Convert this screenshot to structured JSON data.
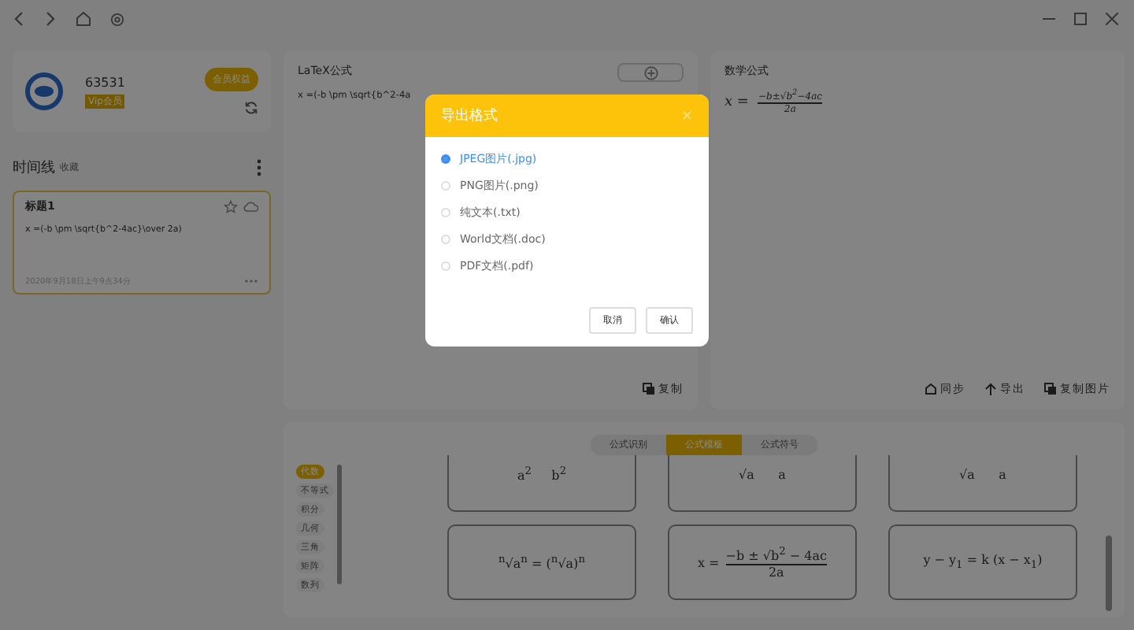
{
  "user": {
    "id": "63531",
    "badge": "Vip会员",
    "action": "会员权益"
  },
  "timeline": {
    "title": "时间线",
    "subtitle": "收藏",
    "cards": [
      {
        "title": "标题1",
        "text": "x =(-b \\pm \\sqrt{b^2-4ac}\\over 2a)",
        "date": "2020年9月18日上午9点34分",
        "selected": true
      }
    ]
  },
  "latex_panel": {
    "title": "LaTeX公式",
    "value": "x =(-b \\pm \\sqrt{b^2-4a",
    "copy": "复制"
  },
  "math_panel": {
    "title": "数学公式",
    "formula": {
      "lhs": "x =",
      "numerator": "−b±√b$^{2}$−4ac",
      "denominator": "2a"
    },
    "actions": [
      "同步",
      "导出",
      "复制图片"
    ]
  },
  "template_tabs": [
    {
      "label": "公式识别",
      "selected": false
    },
    {
      "label": "公式模板",
      "selected": true
    },
    {
      "label": "公式符号",
      "selected": false
    }
  ],
  "categories": [
    {
      "label": "代数",
      "selected": true
    },
    {
      "label": "不等式",
      "selected": false
    },
    {
      "label": "积分",
      "selected": false
    },
    {
      "label": "几何",
      "selected": false
    },
    {
      "label": "三角",
      "selected": false
    },
    {
      "label": "矩阵",
      "selected": false
    },
    {
      "label": "数列",
      "selected": false
    }
  ],
  "formulas": [
    {
      "kind": "text",
      "text": "a$^{2}$     b$^{2}$"
    },
    {
      "kind": "text",
      "text": "√a      a"
    },
    {
      "kind": "text",
      "text": "√a      a"
    },
    {
      "kind": "text",
      "text": "$^{n}$√a$^{n}$ = ($^{n}$√a)$^{n}$"
    },
    {
      "kind": "fraction",
      "lhs": "x =",
      "numerator": "−b ± √b$^{2}$ − 4ac",
      "denominator": "2a"
    },
    {
      "kind": "text",
      "text": "y − y$_{1}$ = k (x − x$_{1}$)"
    }
  ],
  "dialog": {
    "title": "导出格式",
    "close": "×",
    "options": [
      {
        "label": "JPEG图片(.jpg)",
        "selected": true
      },
      {
        "label": "PNG图片(.png)",
        "selected": false
      },
      {
        "label": "纯文本(.txt)",
        "selected": false
      },
      {
        "label": "World文档(.doc)",
        "selected": false
      },
      {
        "label": "PDF文档(.pdf)",
        "selected": false
      }
    ],
    "buttons": [
      "取消",
      "确认"
    ]
  }
}
